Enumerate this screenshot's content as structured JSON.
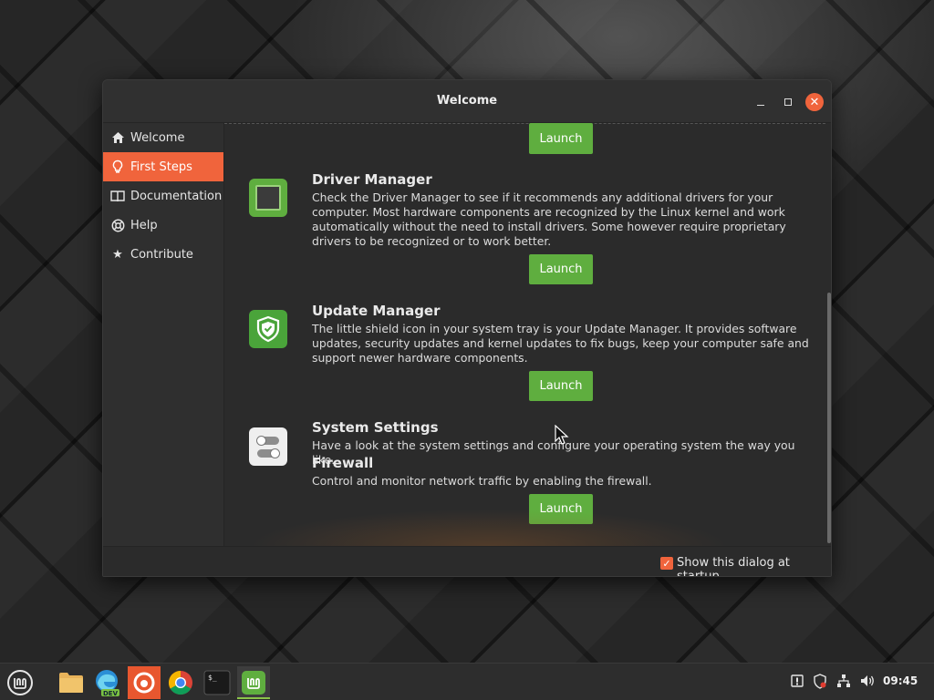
{
  "window": {
    "title": "Welcome"
  },
  "sidebar": {
    "items": [
      {
        "label": "Welcome",
        "icon": "home-icon"
      },
      {
        "label": "First Steps",
        "icon": "lightbulb-icon",
        "active": true
      },
      {
        "label": "Documentation",
        "icon": "book-icon"
      },
      {
        "label": "Help",
        "icon": "lifebuoy-icon"
      },
      {
        "label": "Contribute",
        "icon": "star-icon"
      }
    ]
  },
  "main": {
    "launch_label": "Launch",
    "sections": [
      {
        "title": "Driver Manager",
        "description": "Check the Driver Manager to see if it recommends any additional drivers for your computer. Most hardware components are recognized by the Linux kernel and work automatically without the need to install drivers. Some however require proprietary drivers to be recognized or to work better.",
        "icon": "driver-manager-icon"
      },
      {
        "title": "Update Manager",
        "description": "The little shield icon in your system tray is your Update Manager. It provides software updates, security updates and kernel updates to fix bugs, keep your computer safe and support newer hardware components.",
        "icon": "update-manager-icon"
      },
      {
        "title": "System Settings",
        "description": "Have a look at the system settings and configure your operating system the way you like.",
        "icon": "system-settings-icon"
      },
      {
        "title": "Firewall",
        "description": "Control and monitor network traffic by enabling the firewall."
      }
    ]
  },
  "footer": {
    "startup_label": "Show this dialog at startup",
    "startup_checked": true
  },
  "taskbar": {
    "clock": "09:45",
    "apps": [
      "menu-icon",
      "files-icon",
      "edge-dev-icon",
      "firefox-icon",
      "chrome-icon",
      "terminal-icon",
      "welcome-app-icon"
    ]
  },
  "colors": {
    "accent": "#f0643c",
    "launch": "#5fae3f"
  }
}
